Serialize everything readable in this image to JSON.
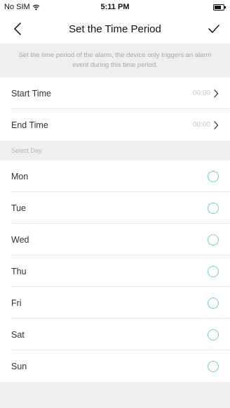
{
  "status_bar": {
    "carrier": "No SIM",
    "time": "5:11 PM",
    "battery_level": 0.7,
    "icons": [
      "wifi-icon",
      "battery-icon"
    ]
  },
  "nav": {
    "title": "Set the Time Period",
    "back_icon": "chevron-left-icon",
    "confirm_icon": "checkmark-icon"
  },
  "description": "Set the time period of the alarm, the device only triggers an alarm event during this time period.",
  "time_rows": [
    {
      "label": "Start Time",
      "value": "00:00"
    },
    {
      "label": "End Time",
      "value": "00:00"
    }
  ],
  "section_label": "Select Day",
  "days": [
    {
      "label": "Mon",
      "selected": false
    },
    {
      "label": "Tue",
      "selected": false
    },
    {
      "label": "Wed",
      "selected": false
    },
    {
      "label": "Thu",
      "selected": false
    },
    {
      "label": "Fri",
      "selected": false
    },
    {
      "label": "Sat",
      "selected": false
    },
    {
      "label": "Sun",
      "selected": false
    }
  ],
  "colors": {
    "accent": "#74d2b4",
    "background": "#efefef",
    "muted_text": "#a9a9a9"
  }
}
